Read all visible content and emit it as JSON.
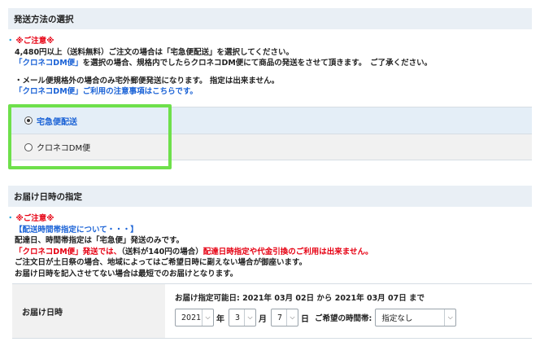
{
  "shipping": {
    "header": "発送方法の選択",
    "notice": {
      "title": "※ご注意※",
      "line1": "4,480円以上（送料無料）ご注文の場合は「宅急便配送」を選択してください。",
      "line2_a": "「クロネコDM便」",
      "line2_b": "を選択の場合、規格内でしたらクロネコDM便にて商品の発送をさせて頂きます。　ご了承ください。",
      "line3": "・メール便規格外の場合のみ宅外郵便発送になります。 指定は出来ません。",
      "line4": "「クロネコDM便」ご利用の注意事項はこちらです。"
    },
    "options": [
      {
        "label": "宅急便配送",
        "selected": true
      },
      {
        "label": "クロネコDM便",
        "selected": false
      }
    ],
    "highlight_color": "#6ee04b"
  },
  "delivery": {
    "header": "お届け日時の指定",
    "notice": {
      "title": "※ご注意※",
      "line1": "【配送時間帯指定について・・・】",
      "line2": "配達日、時間帯指定は「宅急便」発送のみです。",
      "line3_a": "「クロネコDM便」発送では、",
      "line3_b": "（送料が140円の場合）",
      "line3_c": "配達日時指定や代金引換のご利用は出来ません。",
      "line4": "ご注文日が土日祭の場合、地域によってはご希望日時に副えない場合が御座います。",
      "line5": "お届け日時を記入させてない場合は最短でのお届けとなります。"
    },
    "label": "お届け日時",
    "range_text": "お届け指定可能日: 2021年 03月 02日 から 2021年 03月 07日 まで",
    "year": {
      "value": "2021",
      "unit": "年"
    },
    "month": {
      "value": "3",
      "unit": "月"
    },
    "day": {
      "value": "7",
      "unit": "日"
    },
    "time_label": "ご希望の時間帯:",
    "time_value": "指定なし"
  },
  "colors": {
    "header_bg": "#e9eff5",
    "notice_red": "#e60012",
    "link_blue": "#1a62d6"
  }
}
